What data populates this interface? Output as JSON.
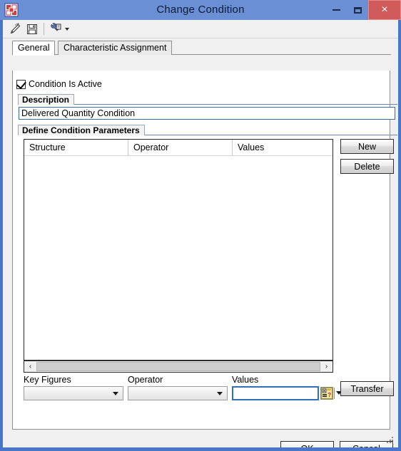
{
  "window": {
    "title": "Change Condition",
    "app_icon": "sap-app-icon",
    "controls": {
      "minimize": "minimize-icon",
      "maximize": "maximize-icon",
      "close": "×"
    }
  },
  "toolbar": {
    "items": [
      {
        "name": "edit-pencil-icon",
        "tooltip": "Change"
      },
      {
        "name": "save-floppy-icon",
        "tooltip": "Save"
      },
      {
        "name": "tools-wrench-icon",
        "tooltip": "Tools",
        "has_dropdown": true
      }
    ]
  },
  "tabs": [
    {
      "label": "General",
      "active": true
    },
    {
      "label": "Characteristic Assignment",
      "active": false
    }
  ],
  "general": {
    "condition_active": {
      "label": "Condition Is Active",
      "checked": true
    },
    "description_group": {
      "title": "Description",
      "value": "Delivered Quantity Condition",
      "placeholder": ""
    },
    "parameters_group": {
      "title": "Define Condition Parameters",
      "table": {
        "columns": [
          "Structure",
          "Operator",
          "Values"
        ],
        "rows": []
      },
      "scrollbar": {
        "left_arrow": "‹",
        "right_arrow": "›"
      },
      "buttons": {
        "new": "New",
        "delete": "Delete",
        "transfer": "Transfer"
      },
      "entry_form": {
        "key_figures_label": "Key Figures",
        "key_figures_value": "",
        "operator_label": "Operator",
        "operator_value": "",
        "values_label": "Values",
        "values_value": "",
        "value_help_icon": "value-help-icon"
      }
    }
  },
  "footer": {
    "ok": "OK",
    "cancel": "Cancel"
  },
  "colors": {
    "titlebar": "#6a8fd4",
    "frame": "#4a76c8",
    "close_button": "#d05a5a",
    "focus_border": "#2f6fbc",
    "group_border": "#6f87b0"
  }
}
